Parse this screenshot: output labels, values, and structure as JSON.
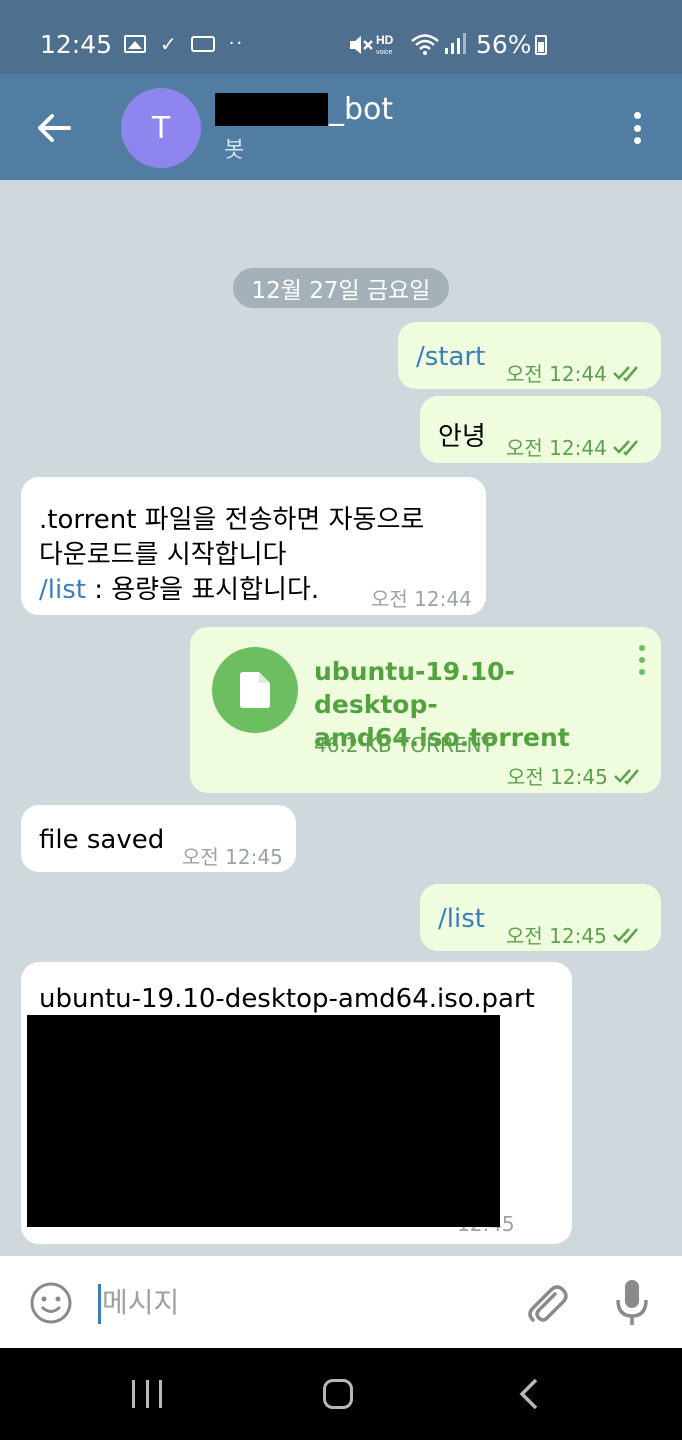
{
  "status_bar": {
    "time": "12:45",
    "battery": "56%",
    "icons": [
      "gallery-icon",
      "check-icon",
      "voicemail-icon",
      "more-dots-icon",
      "mute-icon",
      "hd-voice-icon",
      "wifi-icon",
      "signal-icon",
      "battery-icon"
    ]
  },
  "header": {
    "avatar_letter": "T",
    "title_suffix": "_bot",
    "subtitle": "봇"
  },
  "chat": {
    "date": "12월 27일 금요일",
    "messages": [
      {
        "dir": "out",
        "text": "/start",
        "time": "오전 12:44",
        "read": true
      },
      {
        "dir": "out",
        "text": "안녕",
        "time": "오전 12:44",
        "read": true
      },
      {
        "dir": "in",
        "line1": ".torrent 파일을 전송하면 자동으로",
        "line2": "다운로드를 시작합니다",
        "cmd": "/list",
        "line3_rest": " : 용량을 표시합니다.",
        "time": "오전 12:44"
      },
      {
        "dir": "out",
        "file_name": "ubuntu-19.10-desktop-amd64.iso.torrent",
        "file_size": "46.2 KB TORRENT",
        "time": "오전 12:45",
        "read": true
      },
      {
        "dir": "in",
        "text": "file saved",
        "time": "오전 12:45"
      },
      {
        "dir": "out",
        "text": "/list",
        "time": "오전 12:45",
        "read": true
      },
      {
        "dir": "in",
        "text": "ubuntu-19.10-desktop-amd64.iso.part",
        "time": "12:45"
      }
    ]
  },
  "input": {
    "placeholder": "메시지"
  },
  "colors": {
    "header_bg": "#527da3",
    "status_bg": "#4f6f8f",
    "out_bubble": "#effdde",
    "in_bubble": "#ffffff",
    "link": "#3a7ebf",
    "file_green": "#6dbd61",
    "avatar": "#8e85ee"
  }
}
